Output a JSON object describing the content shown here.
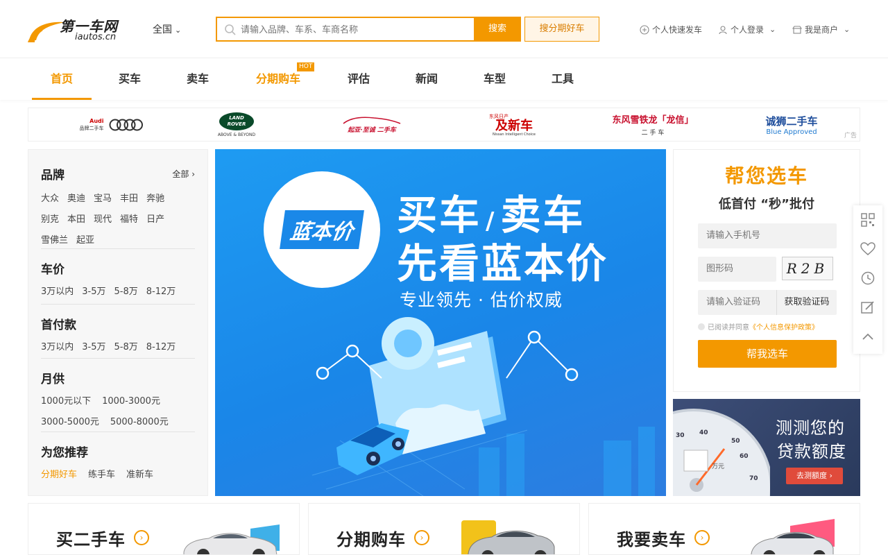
{
  "logo": {
    "name": "第一车网",
    "url": "iautos.cn"
  },
  "header": {
    "city": "全国",
    "search_placeholder": "请输入品牌、车系、车商名称",
    "search_button": "搜索",
    "installment_button": "搜分期好车",
    "quick_post": "个人快速发车",
    "login": "个人登录",
    "merchant": "我是商户"
  },
  "nav": {
    "items": [
      "首页",
      "买车",
      "卖车",
      "分期购车",
      "评估",
      "新闻",
      "车型",
      "工具"
    ],
    "hot_badge": "HOT"
  },
  "brand_bar": {
    "ad_label": "广告",
    "audi": {
      "name": "Audi",
      "sub": "品牌二手车"
    },
    "landrover": {
      "line1": "LAND",
      "line2": "ROVER",
      "tagline": "ABOVE & BEYOND"
    },
    "kia": "起亚·至诚 二手车",
    "nissan": {
      "top": "东风日产",
      "main": "及新车",
      "sub": "Nissan Intelligent Choice"
    },
    "citroen": {
      "main": "东风雪铁龙「龙信」",
      "sub": "二 手 车"
    },
    "peugeot": {
      "main": "诚狮二手车",
      "sub": "Blue Approved"
    }
  },
  "sidebar": {
    "brand": {
      "title": "品牌",
      "all": "全部",
      "items": [
        "大众",
        "奥迪",
        "宝马",
        "丰田",
        "奔驰",
        "别克",
        "本田",
        "现代",
        "福特",
        "日产",
        "雪佛兰",
        "起亚"
      ]
    },
    "price": {
      "title": "车价",
      "items": [
        "3万以内",
        "3-5万",
        "5-8万",
        "8-12万"
      ]
    },
    "down": {
      "title": "首付款",
      "items": [
        "3万以内",
        "3-5万",
        "5-8万",
        "8-12万"
      ]
    },
    "monthly": {
      "title": "月供",
      "items": [
        "1000元以下",
        "1000-3000元",
        "3000-5000元",
        "5000-8000元"
      ]
    },
    "recommend": {
      "title": "为您推荐",
      "items": [
        "分期好车",
        "练手车",
        "准新车"
      ]
    }
  },
  "banner": {
    "logo_text": "蓝本价",
    "line1a": "买车",
    "slash": "/",
    "line1b": "卖车",
    "line2": "先看蓝本价",
    "line3": "专业领先 · 估价权威"
  },
  "select_panel": {
    "title": "帮您选车",
    "subtitle": "低首付 “秒”批付",
    "phone_placeholder": "请输入手机号",
    "captcha_placeholder": "图形码",
    "captcha_text": "R2B",
    "code_placeholder": "请输入验证码",
    "get_code": "获取验证码",
    "agree_prefix": "已阅读并同意",
    "agree_link": "《个人信息保护政策》",
    "submit": "帮我选车"
  },
  "loan_panel": {
    "line1": "测测您的",
    "line2": "贷款额度",
    "button": "去测额度 ›",
    "unit": "万元",
    "ticks": [
      "30",
      "40",
      "50",
      "60",
      "70"
    ]
  },
  "cards": [
    {
      "title": "买二手车"
    },
    {
      "title": "分期购车"
    },
    {
      "title": "我要卖车"
    }
  ],
  "colors": {
    "accent": "#f39800",
    "banner": "#1e8ef0",
    "loan_bg": "#2f3f63"
  }
}
